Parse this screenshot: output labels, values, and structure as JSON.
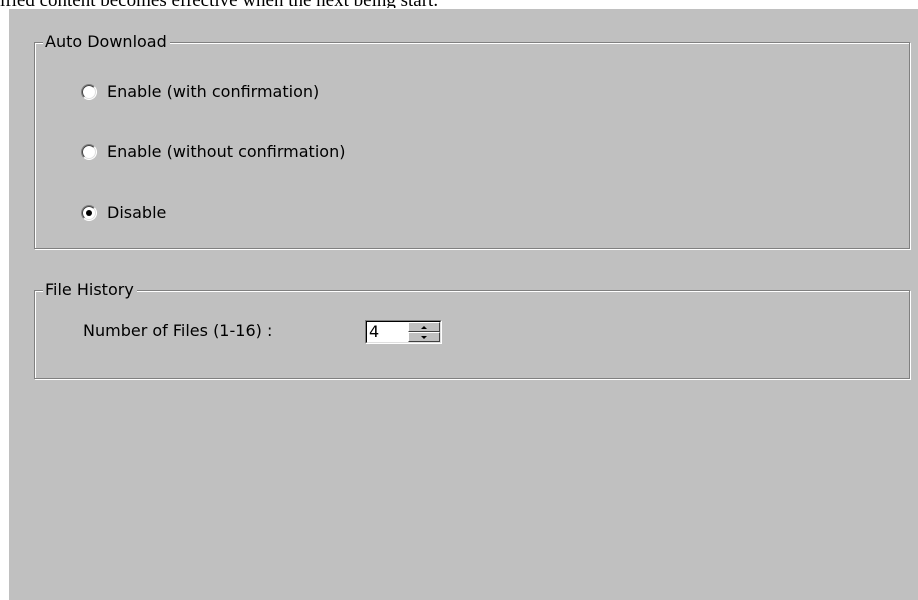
{
  "note": "ified content becomes effective when the next being start.",
  "auto_download": {
    "title": "Auto Download",
    "options": [
      {
        "label": "Enable (with confirmation)",
        "selected": false
      },
      {
        "label": "Enable (without confirmation)",
        "selected": false
      },
      {
        "label": "Disable",
        "selected": true
      }
    ]
  },
  "file_history": {
    "title": "File History",
    "number_label": "Number of Files (1-16) :",
    "number_value": "4"
  }
}
